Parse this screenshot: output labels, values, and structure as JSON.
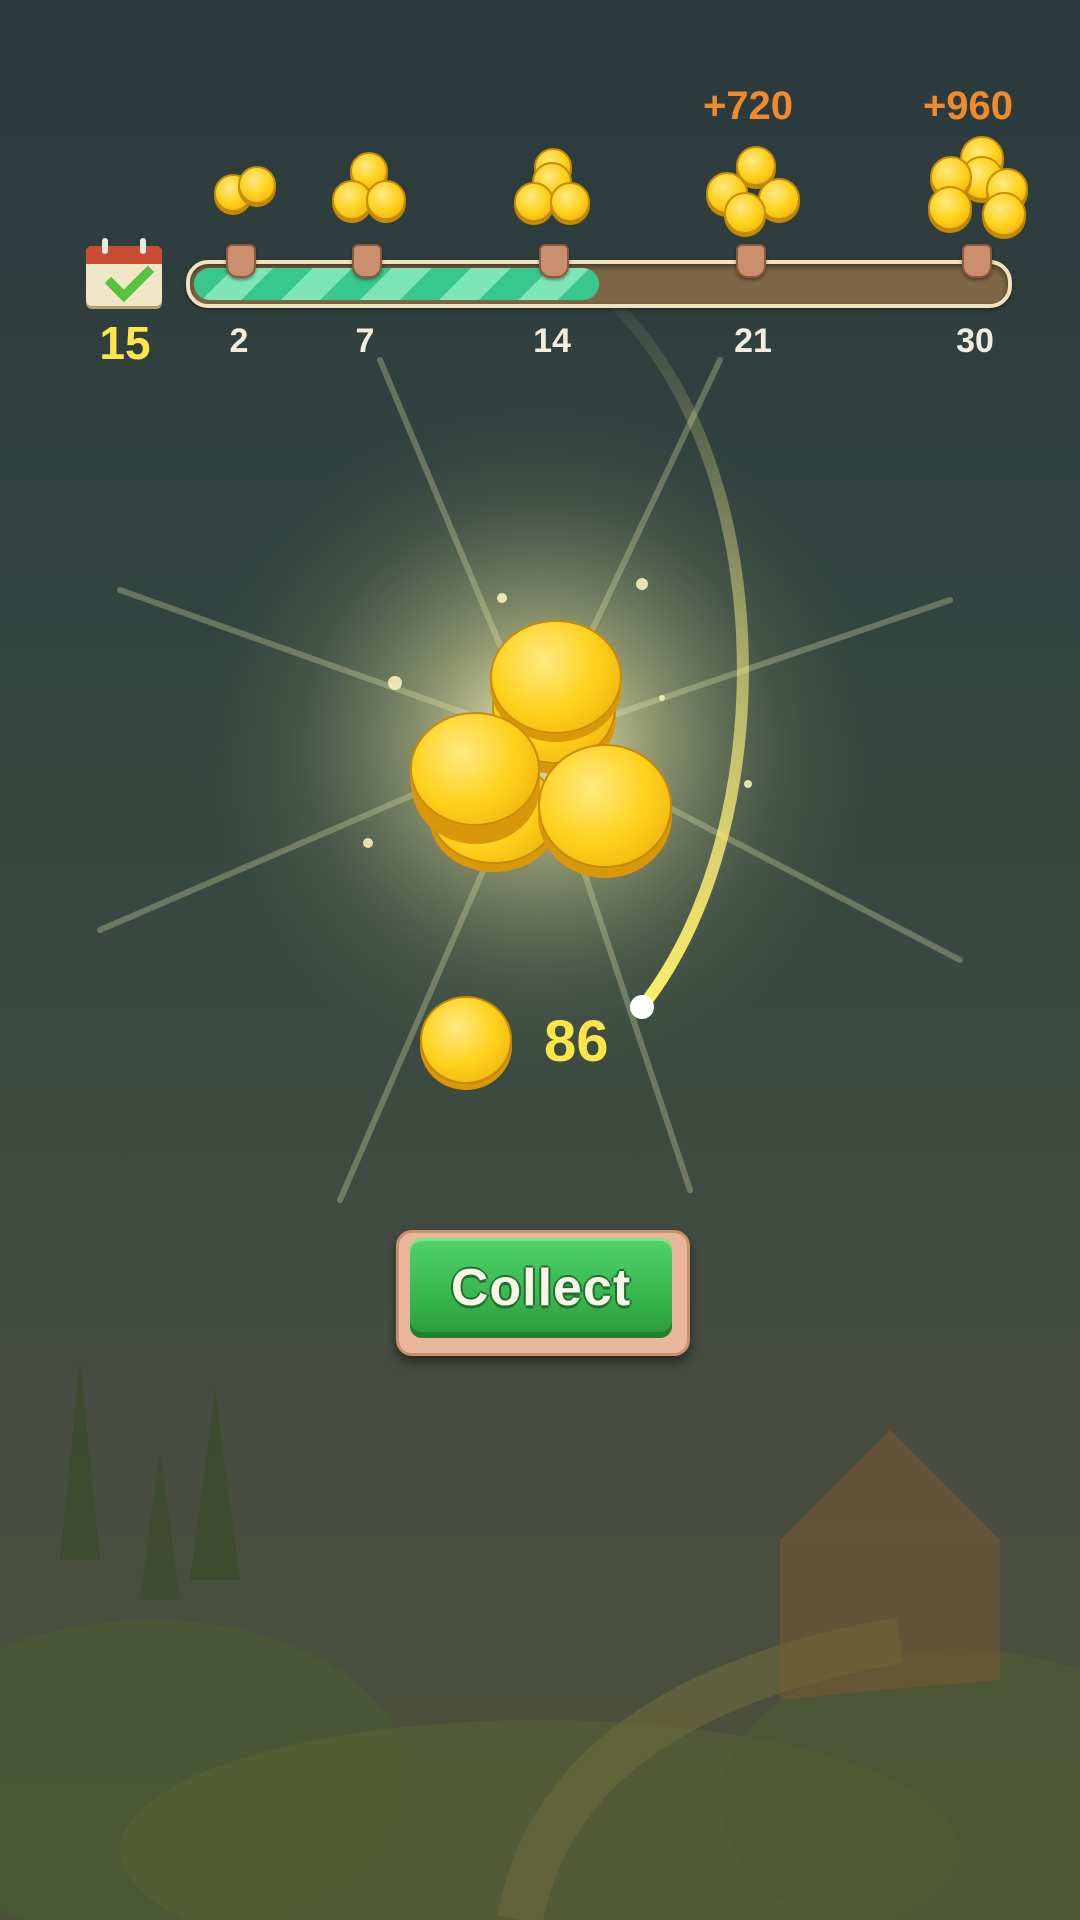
{
  "progress": {
    "current_day": "15",
    "milestones": [
      {
        "day": "2",
        "bonus": ""
      },
      {
        "day": "7",
        "bonus": ""
      },
      {
        "day": "14",
        "bonus": ""
      },
      {
        "day": "21",
        "bonus": "+720"
      },
      {
        "day": "30",
        "bonus": "+960"
      }
    ],
    "fill_fraction": 0.5
  },
  "reward": {
    "amount": "86",
    "icon": "coin-icon"
  },
  "collect_button": {
    "label": "Collect"
  },
  "colors": {
    "accent_yellow": "#ffe44a",
    "bonus_orange": "#f08a2b",
    "button_green": "#36b64c",
    "progress_green": "#38c88f"
  }
}
